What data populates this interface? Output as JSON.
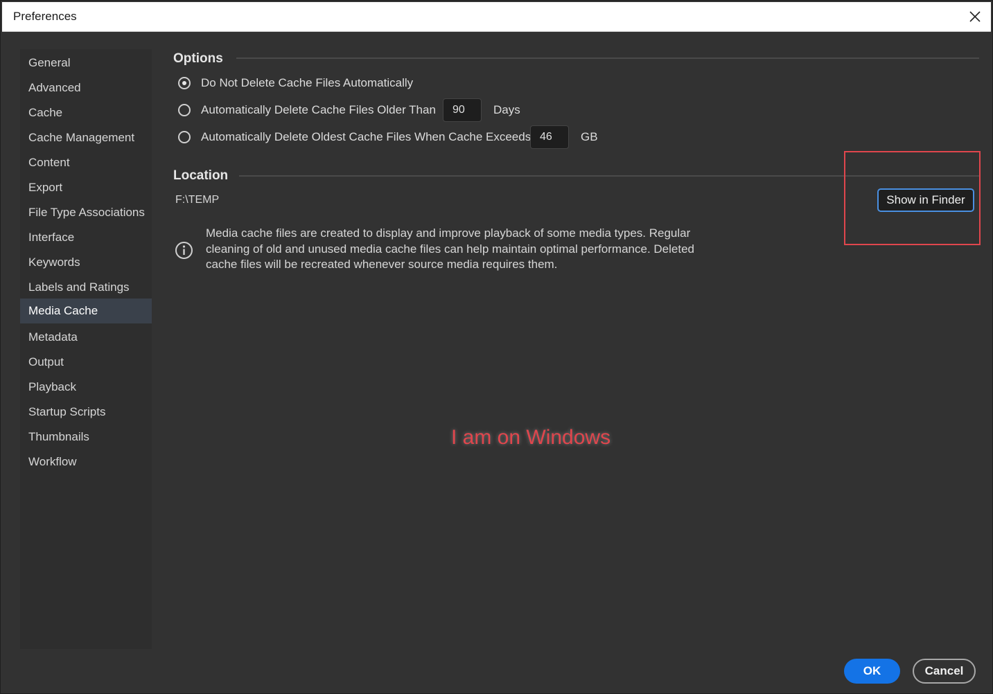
{
  "window": {
    "title": "Preferences"
  },
  "sidebar": {
    "items": [
      {
        "label": "General"
      },
      {
        "label": "Advanced"
      },
      {
        "label": "Cache"
      },
      {
        "label": "Cache Management"
      },
      {
        "label": "Content"
      },
      {
        "label": "Export"
      },
      {
        "label": "File Type Associations"
      },
      {
        "label": "Interface"
      },
      {
        "label": "Keywords"
      },
      {
        "label": "Labels and Ratings"
      },
      {
        "label": "Media Cache"
      },
      {
        "label": "Metadata"
      },
      {
        "label": "Output"
      },
      {
        "label": "Playback"
      },
      {
        "label": "Startup Scripts"
      },
      {
        "label": "Thumbnails"
      },
      {
        "label": "Workflow"
      }
    ],
    "active": "Media Cache"
  },
  "options": {
    "title": "Options",
    "radios": [
      {
        "label": "Do Not Delete Cache Files Automatically",
        "checked": true
      },
      {
        "label": "Automatically Delete Cache Files Older Than",
        "checked": false,
        "value": "90",
        "unit": "Days"
      },
      {
        "label": "Automatically Delete Oldest Cache Files When Cache Exceeds",
        "checked": false,
        "value": "46",
        "unit": "GB"
      }
    ]
  },
  "location": {
    "title": "Location",
    "path": "F:\\TEMP",
    "show_button": "Show in Finder"
  },
  "info": {
    "text": "Media cache files are created to display and improve playback of some media types. Regular cleaning of old and unused media cache files can help maintain optimal performance. Deleted cache files will be recreated whenever source media requires them."
  },
  "annotation": {
    "text": "I am on Windows",
    "color": "#e0464d"
  },
  "footer": {
    "ok_label": "OK",
    "cancel_label": "Cancel"
  },
  "colors": {
    "accent": "#1473e6",
    "focus_ring": "#4a90e2",
    "highlight": "#e0464d"
  }
}
